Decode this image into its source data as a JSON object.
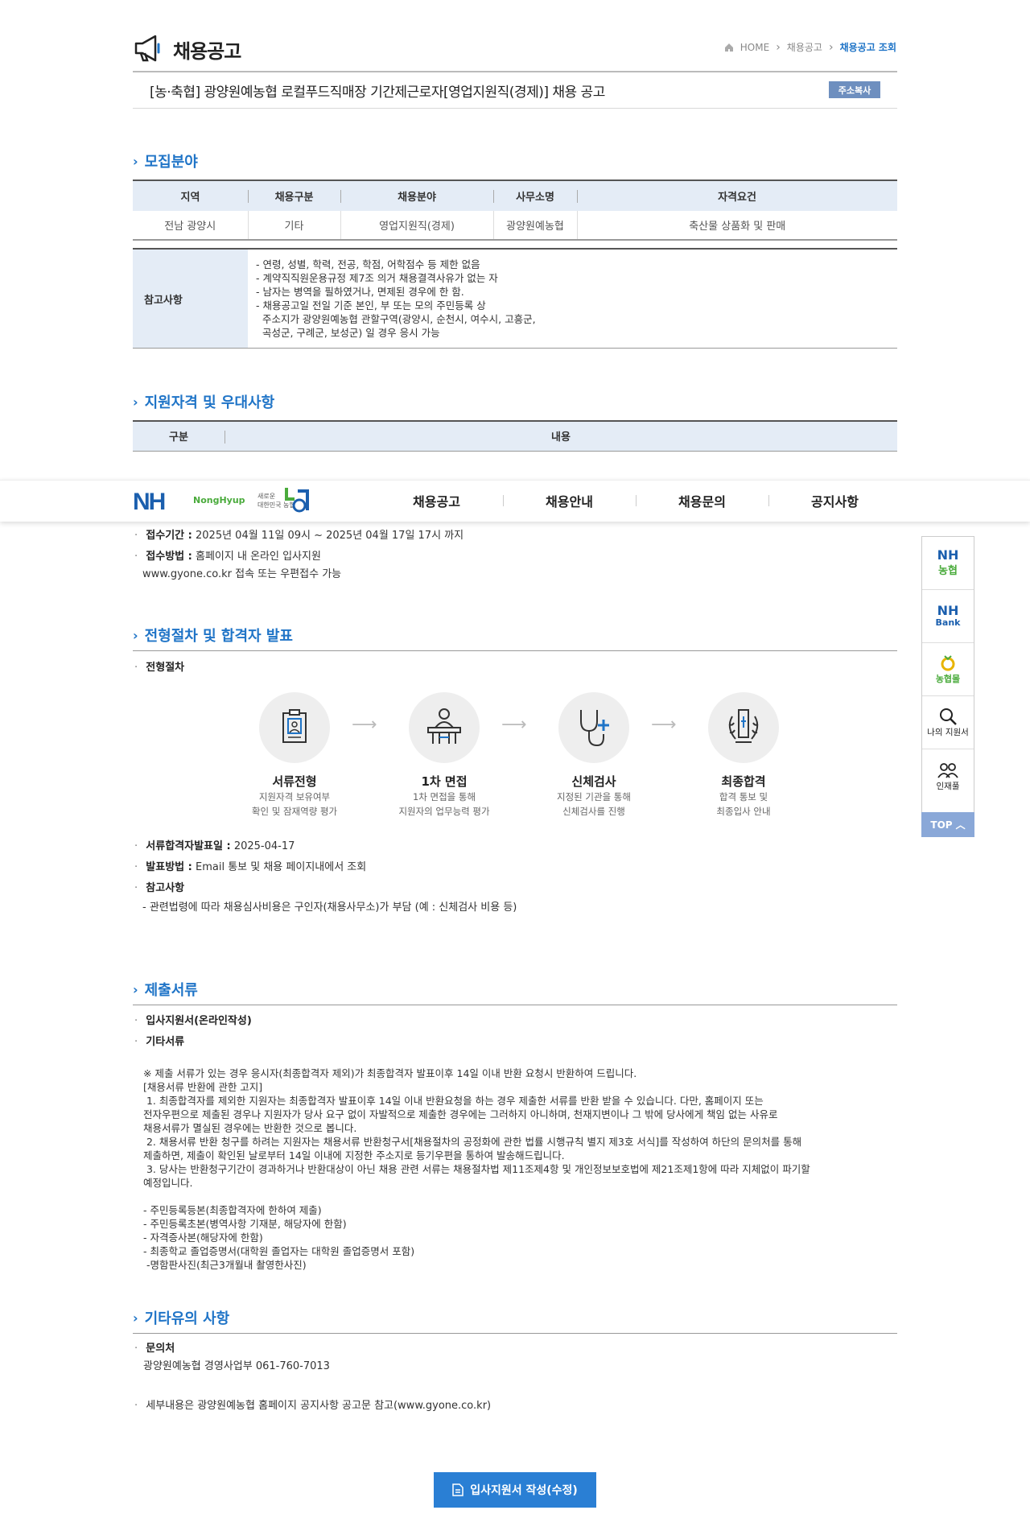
{
  "header": {
    "title": "채용공고",
    "breadcrumb": {
      "home": "HOME",
      "section": "채용공고",
      "current": "채용공고 조회"
    }
  },
  "posting": {
    "title": "[농·축협] 광양원예농협 로컬푸드직매장 기간제근로자[영업지원직(경제)] 채용 공고",
    "copy_label": "주소복사"
  },
  "recruit": {
    "heading": "모집분야",
    "columns": [
      "지역",
      "채용구분",
      "채용분야",
      "사무소명",
      "자격요건"
    ],
    "row": [
      "전남 광양시",
      "기타",
      "영업지원직(경제)",
      "광양원예농협",
      "축산물 상품화 및 판매"
    ],
    "note_label": "참고사항",
    "notes": [
      "- 연령, 성별, 학력, 전공, 학점, 어학점수 등 제한 없음",
      "- 계약직직원운용규정 제7조 의거 채용결격사유가 없는 자",
      "- 남자는 병역을 필하였거나, 면제된 경우에 한 함.",
      "- 채용공고일 전일 기준 본인, 부 또는 모의 주민등록 상",
      "  주소지가 광양원예농협 관할구역(광양시, 순천시, 여수시, 고흥군,",
      "  곡성군, 구례군, 보성군) 일 경우 응시 가능"
    ]
  },
  "qualification": {
    "heading": "지원자격 및 우대사항",
    "columns": [
      "구분",
      "내용"
    ]
  },
  "nav": {
    "logo": "NH",
    "logo_sub": "NongHyup",
    "slogan_1": "새로운",
    "slogan_2": "대한민국 농협",
    "items": [
      "채용공고",
      "채용안내",
      "채용문의",
      "공지사항"
    ]
  },
  "application": {
    "period_label": "접수기간 :",
    "period": "2025년 04월 11일 09시 ~ 2025년 04월 17일 17시 까지",
    "method_label": "접수방법 :",
    "method": "홈페이지 내 온라인 입사지원",
    "method_2": "www.gyone.co.kr 접속 또는 우편접수 가능"
  },
  "process": {
    "heading": "전형절차 및 합격자 발표",
    "sub_label": "전형절차",
    "steps": [
      {
        "title": "서류전형",
        "desc1": "지원자격 보유여부",
        "desc2": "확인 및 잠재역량 평가",
        "icon": "document-icon"
      },
      {
        "title": "1차 면접",
        "desc1": "1차 면접을 통해",
        "desc2": "지원자의 업무능력 평가",
        "icon": "interview-icon"
      },
      {
        "title": "신체검사",
        "desc1": "지정된 기관을 통해",
        "desc2": "신체검사를 진행",
        "icon": "stethoscope-icon"
      },
      {
        "title": "최종합격",
        "desc1": "합격 통보 및",
        "desc2": "최종입사 안내",
        "icon": "laurel-icon"
      }
    ],
    "announce_label": "서류합격자발표일 :",
    "announce": "2025-04-17",
    "announce_method_label": "발표방법 :",
    "announce_method": "Email 통보 및 채용 페이지내에서 조회",
    "ref_label": "참고사항",
    "ref": "- 관련법령에 따라 채용심사비용은 구인자(채용사무소)가 부담 (예 : 신체검사 비용 등)"
  },
  "documents": {
    "heading": "제출서류",
    "online_label": "입사지원서(온라인작성)",
    "other_label": "기타서류",
    "lines": [
      "※ 제출 서류가 있는 경우 응시자(최종합격자 제외)가 최종합격자 발표이후 14일 이내 반환 요청시 반환하여 드립니다.",
      "[채용서류 반환에 관한 고지]",
      " 1. 최종합격자를 제외한 지원자는 최종합격자 발표이후 14일 이내 반환요청을 하는 경우 제출한 서류를 반환 받을 수 있습니다. 다만, 홈페이지 또는",
      "전자우편으로 제출된 경우나 지원자가 당사 요구 없이 자발적으로 제출한 경우에는 그러하지 아니하며, 천재지변이나 그 밖에 당사에게 책임 없는 사유로",
      "채용서류가 멸실된 경우에는 반환한 것으로 봅니다.",
      " 2. 채용서류 반환 청구를 하려는 지원자는 채용서류 반환청구서[채용절차의 공정화에 관한 법률 시행규칙 별지 제3호 서식]를 작성하여 하단의 문의처를 통해",
      "제출하면, 제출이 확인된 날로부터 14일 이내에 지정한 주소지로 등기우편을 통하여 발송해드립니다.",
      " 3. 당사는 반환청구기간이 경과하거나 반환대상이 아닌 채용 관련 서류는 채용절차법 제11조제4항 및 개인정보보호법에 제21조제1항에 따라 지체없이 파기할",
      "예정입니다.",
      "",
      "- 주민등록등본(최종합격자에 한하여 제출)",
      "- 주민등록초본(병역사항 기재분, 해당자에 한함)",
      "- 자격증사본(해당자에 한함)",
      "- 최종학교 졸업증명서(대학원 졸업자는 대학원 졸업증명서 포함)",
      " -명함판사진(최근3개월내 촬영한사진)"
    ]
  },
  "etc": {
    "heading": "기타유의 사항",
    "contact_label": "문의처",
    "contact": "광양원예농협 경영사업부 061-760-7013",
    "detail": "세부내용은 광양원예농협 홈페이지 공지사항 공고문 참고(www.gyone.co.kr)"
  },
  "quickbar": {
    "nh_nonghyup_1": "NH",
    "nh_nonghyup_2": "농협",
    "nh_bank_1": "NH",
    "nh_bank_2": "Bank",
    "mall": "농협몰",
    "my_apply": "나의 지원서",
    "talent": "인재풀",
    "top": "TOP"
  },
  "apply_button": "입사지원서 작성(수정)",
  "colors": {
    "accent": "#1f74c7",
    "table_head": "#e4ecf6",
    "button": "#2a7fd4"
  }
}
